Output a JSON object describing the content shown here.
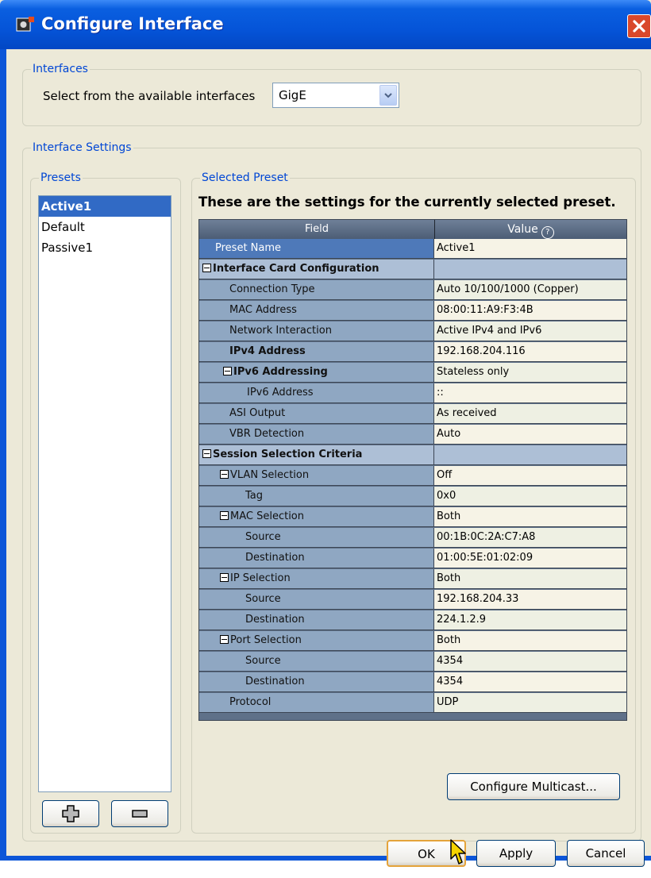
{
  "window": {
    "title": "Configure Interface"
  },
  "interfaces": {
    "legend": "Interfaces",
    "prompt": "Select from the available interfaces",
    "selected": "GigE"
  },
  "settings": {
    "legend": "Interface Settings"
  },
  "presets": {
    "legend": "Presets",
    "items": [
      "Active1",
      "Default",
      "Passive1"
    ],
    "selected_index": 0
  },
  "selected_preset": {
    "legend": "Selected Preset",
    "heading": "These are the settings for the currently selected preset.",
    "col_field": "Field",
    "col_value": "Value",
    "rows": [
      {
        "field": "Preset Name",
        "value": "Active1"
      },
      {
        "field": "Interface Card Configuration",
        "value": ""
      },
      {
        "field": "Connection Type",
        "value": "Auto 10/100/1000 (Copper)"
      },
      {
        "field": "MAC Address",
        "value": "08:00:11:A9:F3:4B"
      },
      {
        "field": "Network Interaction",
        "value": "Active IPv4 and IPv6"
      },
      {
        "field": "IPv4 Address",
        "value": "192.168.204.116"
      },
      {
        "field": "IPv6 Addressing",
        "value": "Stateless only"
      },
      {
        "field": "IPv6 Address",
        "value": "::"
      },
      {
        "field": "ASI Output",
        "value": "As received"
      },
      {
        "field": "VBR Detection",
        "value": "Auto"
      },
      {
        "field": "Session Selection Criteria",
        "value": ""
      },
      {
        "field": "VLAN Selection",
        "value": "Off"
      },
      {
        "field": "Tag",
        "value": "0x0"
      },
      {
        "field": "MAC Selection",
        "value": "Both"
      },
      {
        "field": "Source",
        "value": "00:1B:0C:2A:C7:A8"
      },
      {
        "field": "Destination",
        "value": "01:00:5E:01:02:09"
      },
      {
        "field": "IP Selection",
        "value": "Both"
      },
      {
        "field": "Source",
        "value": "192.168.204.33"
      },
      {
        "field": "Destination",
        "value": "224.1.2.9"
      },
      {
        "field": "Port Selection",
        "value": "Both"
      },
      {
        "field": "Source",
        "value": "4354"
      },
      {
        "field": "Destination",
        "value": "4354"
      },
      {
        "field": "Protocol",
        "value": "UDP"
      }
    ]
  },
  "buttons": {
    "configure_multicast": "Configure Multicast...",
    "ok": "OK",
    "apply": "Apply",
    "cancel": "Cancel"
  },
  "colors": {
    "title_bar": "#0554d8",
    "selection": "#316ac5",
    "grid_field": "#8fa7c2",
    "grid_value": "#f6f3e6"
  }
}
